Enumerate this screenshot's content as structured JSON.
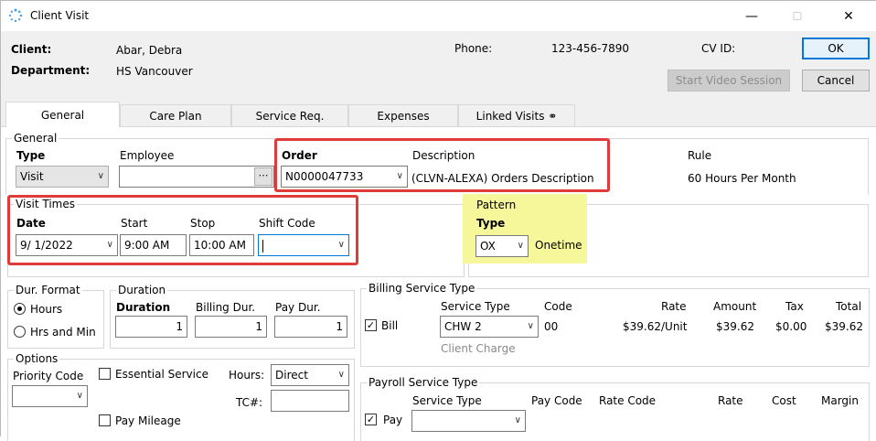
{
  "window": {
    "title": "Client Visit",
    "minimize": "—",
    "maximize": "☐",
    "close": "✕"
  },
  "header": {
    "client_label": "Client:",
    "client_value": "Abar, Debra",
    "department_label": "Department:",
    "department_value": "HS Vancouver",
    "phone_label": "Phone:",
    "phone_value": "123-456-7890",
    "cvid_label": "CV ID:",
    "ok_label": "OK",
    "cancel_label": "Cancel",
    "video_label": "Start Video Session"
  },
  "tabs": [
    "General",
    "Care Plan",
    "Service Req.",
    "Expenses",
    "Linked Visits ⚭"
  ],
  "general": {
    "group_title": "General",
    "type_label": "Type",
    "type_value": "Visit",
    "employee_label": "Employee",
    "employee_value": "",
    "order_label": "Order",
    "order_value": "N0000047733",
    "description_label": "Description",
    "description_value": "(CLVN-ALEXA) Orders Description",
    "rule_label": "Rule",
    "rule_value": "60 Hours Per Month"
  },
  "visit_times": {
    "group_title": "Visit Times",
    "date_label": "Date",
    "date_value": "9/  1/2022",
    "start_label": "Start",
    "start_value": "9:00 AM",
    "stop_label": "Stop",
    "stop_value": "10:00 AM",
    "shift_label": "Shift Code",
    "shift_value": ""
  },
  "pattern": {
    "group_title": "Pattern",
    "type_label": "Type",
    "type_value": "OX",
    "type_desc": "Onetime"
  },
  "dur_format": {
    "group_title": "Dur. Format",
    "hours_label": "Hours",
    "hrs_min_label": "Hrs and Min"
  },
  "duration": {
    "group_title": "Duration",
    "duration_label": "Duration",
    "duration_value": "1",
    "billing_label": "Billing Dur.",
    "billing_value": "1",
    "pay_label": "Pay Dur.",
    "pay_value": "1"
  },
  "options": {
    "group_title": "Options",
    "priority_label": "Priority Code",
    "priority_value": "",
    "essential_label": "Essential Service",
    "hours_label": "Hours:",
    "hours_value": "Direct",
    "tc_label": "TC#:",
    "tc_value": "",
    "mileage_label": "Pay Mileage"
  },
  "billing": {
    "group_title": "Billing Service Type",
    "headers": {
      "service_type": "Service Type",
      "code": "Code",
      "rate": "Rate",
      "amount": "Amount",
      "tax": "Tax",
      "total": "Total"
    },
    "bill_label": "Bill",
    "service_type_value": "CHW 2",
    "code_value": "00",
    "rate_value": "$39.62/Unit",
    "amount_value": "$39.62",
    "tax_value": "$0.00",
    "total_value": "$39.62",
    "sub_label": "Client Charge"
  },
  "payroll": {
    "group_title": "Payroll Service Type",
    "headers": {
      "service_type": "Service Type",
      "pay_code": "Pay Code",
      "rate_code": "Rate Code",
      "rate": "Rate",
      "cost": "Cost",
      "margin": "Margin"
    },
    "pay_label": "Pay",
    "service_type_value": ""
  },
  "colors": {
    "highlight_red": "#e03b3b",
    "highlight_yellow": "#f6f79b",
    "ok_border": "#0078d7"
  }
}
